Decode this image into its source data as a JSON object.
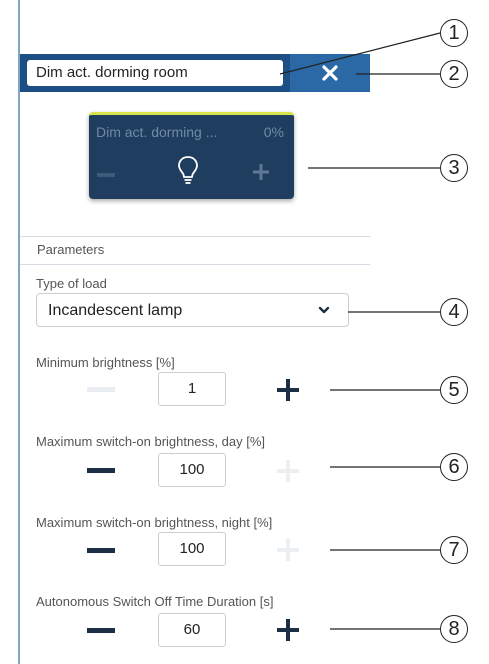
{
  "header": {
    "name_value": "Dim act. dorming room",
    "close_icon": "close-icon"
  },
  "tile": {
    "name": "Dim act. dorming ...",
    "value": "0%",
    "icons": [
      "minus-icon",
      "bulb-icon",
      "plus-icon"
    ],
    "accent": "#d8e24a"
  },
  "parameters": {
    "title": "Parameters",
    "type_of_load": {
      "label": "Type of load",
      "value": "Incandescent lamp"
    },
    "min_brightness": {
      "label": "Minimum brightness [%]",
      "value": "1",
      "minus_enabled": false,
      "plus_enabled": true
    },
    "max_day": {
      "label": "Maximum switch-on brightness, day [%]",
      "value": "100",
      "minus_enabled": true,
      "plus_enabled": false
    },
    "max_night": {
      "label": "Maximum switch-on brightness, night [%]",
      "value": "100",
      "minus_enabled": true,
      "plus_enabled": false
    },
    "auto_off": {
      "label": "Autonomous Switch Off Time Duration [s]",
      "value": "60",
      "minus_enabled": true,
      "plus_enabled": true
    }
  },
  "callouts": [
    "1",
    "2",
    "3",
    "4",
    "5",
    "6",
    "7",
    "8"
  ],
  "colors": {
    "header": "#1c4f83",
    "close": "#2b69a6",
    "tile": "#1f3d5e",
    "stepper_dark": "#1c2f44"
  }
}
